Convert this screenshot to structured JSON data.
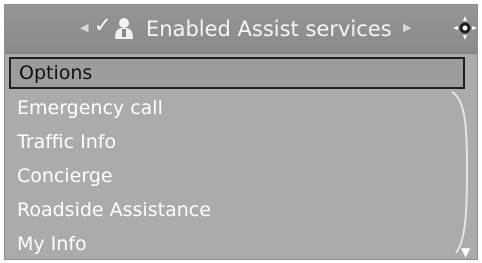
{
  "header": {
    "title": "Enabled Assist services",
    "left_arrow_icon": "triangle-left-icon",
    "right_arrow_icon": "triangle-right-icon",
    "check_icon": "checkmark-icon",
    "person_icon": "assist-person-icon",
    "joystick_icon": "controller-icon"
  },
  "menu": {
    "items": [
      {
        "label": "Options",
        "selected": true
      },
      {
        "label": "Emergency call"
      },
      {
        "label": "Traffic Info"
      },
      {
        "label": "Concierge"
      },
      {
        "label": "Roadside Assistance"
      },
      {
        "label": "My Info"
      }
    ],
    "scroll_down_icon": "scroll-down-arrow-icon"
  },
  "colors": {
    "background": "#ababab",
    "header": "#8f8f8f",
    "text": "#ffffff",
    "selected_border": "#1f1f1f"
  }
}
